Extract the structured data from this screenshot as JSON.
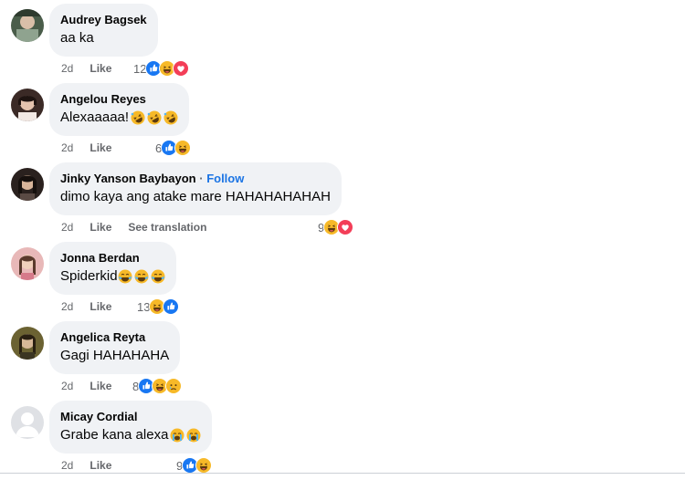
{
  "comments": [
    {
      "author": "Audrey Bagsek",
      "text": "aa ka",
      "time": "2d",
      "like_label": "Like",
      "reaction_count": "12",
      "reactions": [
        "like-icon",
        "haha-icon",
        "love-icon"
      ],
      "text_emoji": []
    },
    {
      "author": "Angelou Reyes",
      "text": "Alexaaaaa!",
      "time": "2d",
      "like_label": "Like",
      "reaction_count": "6",
      "reactions": [
        "like-icon",
        "haha-icon"
      ],
      "text_emoji": [
        "rofl-emoji",
        "rofl-emoji",
        "rofl-emoji"
      ]
    },
    {
      "author": "Jinky Yanson Baybayon",
      "follow_label": "Follow",
      "text": "dimo kaya ang atake mare HAHAHAHAHAH",
      "time": "2d",
      "like_label": "Like",
      "translation_label": "See translation",
      "reaction_count": "9",
      "reactions": [
        "haha-icon",
        "love-icon"
      ],
      "text_emoji": []
    },
    {
      "author": "Jonna Berdan",
      "text": "Spiderkid",
      "time": "2d",
      "like_label": "Like",
      "reaction_count": "13",
      "reactions": [
        "haha-icon",
        "like-icon"
      ],
      "text_emoji": [
        "joy-emoji",
        "joy-emoji",
        "joy-emoji"
      ]
    },
    {
      "author": "Angelica Reyta",
      "text": "Gagi HAHAHAHA",
      "time": "2d",
      "like_label": "Like",
      "reaction_count": "8",
      "reactions": [
        "like-icon",
        "haha-icon",
        "sad-icon"
      ],
      "text_emoji": []
    },
    {
      "author": "Micay Cordial",
      "text": "Grabe kana alexa",
      "time": "2d",
      "like_label": "Like",
      "reaction_count": "9",
      "reactions": [
        "like-icon",
        "haha-icon"
      ],
      "text_emoji": [
        "crying-emoji",
        "crying-emoji"
      ]
    }
  ],
  "colors": {
    "bubble": "#f0f2f5",
    "meta": "#65676b",
    "like_blue": "#1877f2",
    "love_red": "#f33e58",
    "haha_yellow": "#f7b928",
    "follow_blue": "#1b74e4"
  }
}
